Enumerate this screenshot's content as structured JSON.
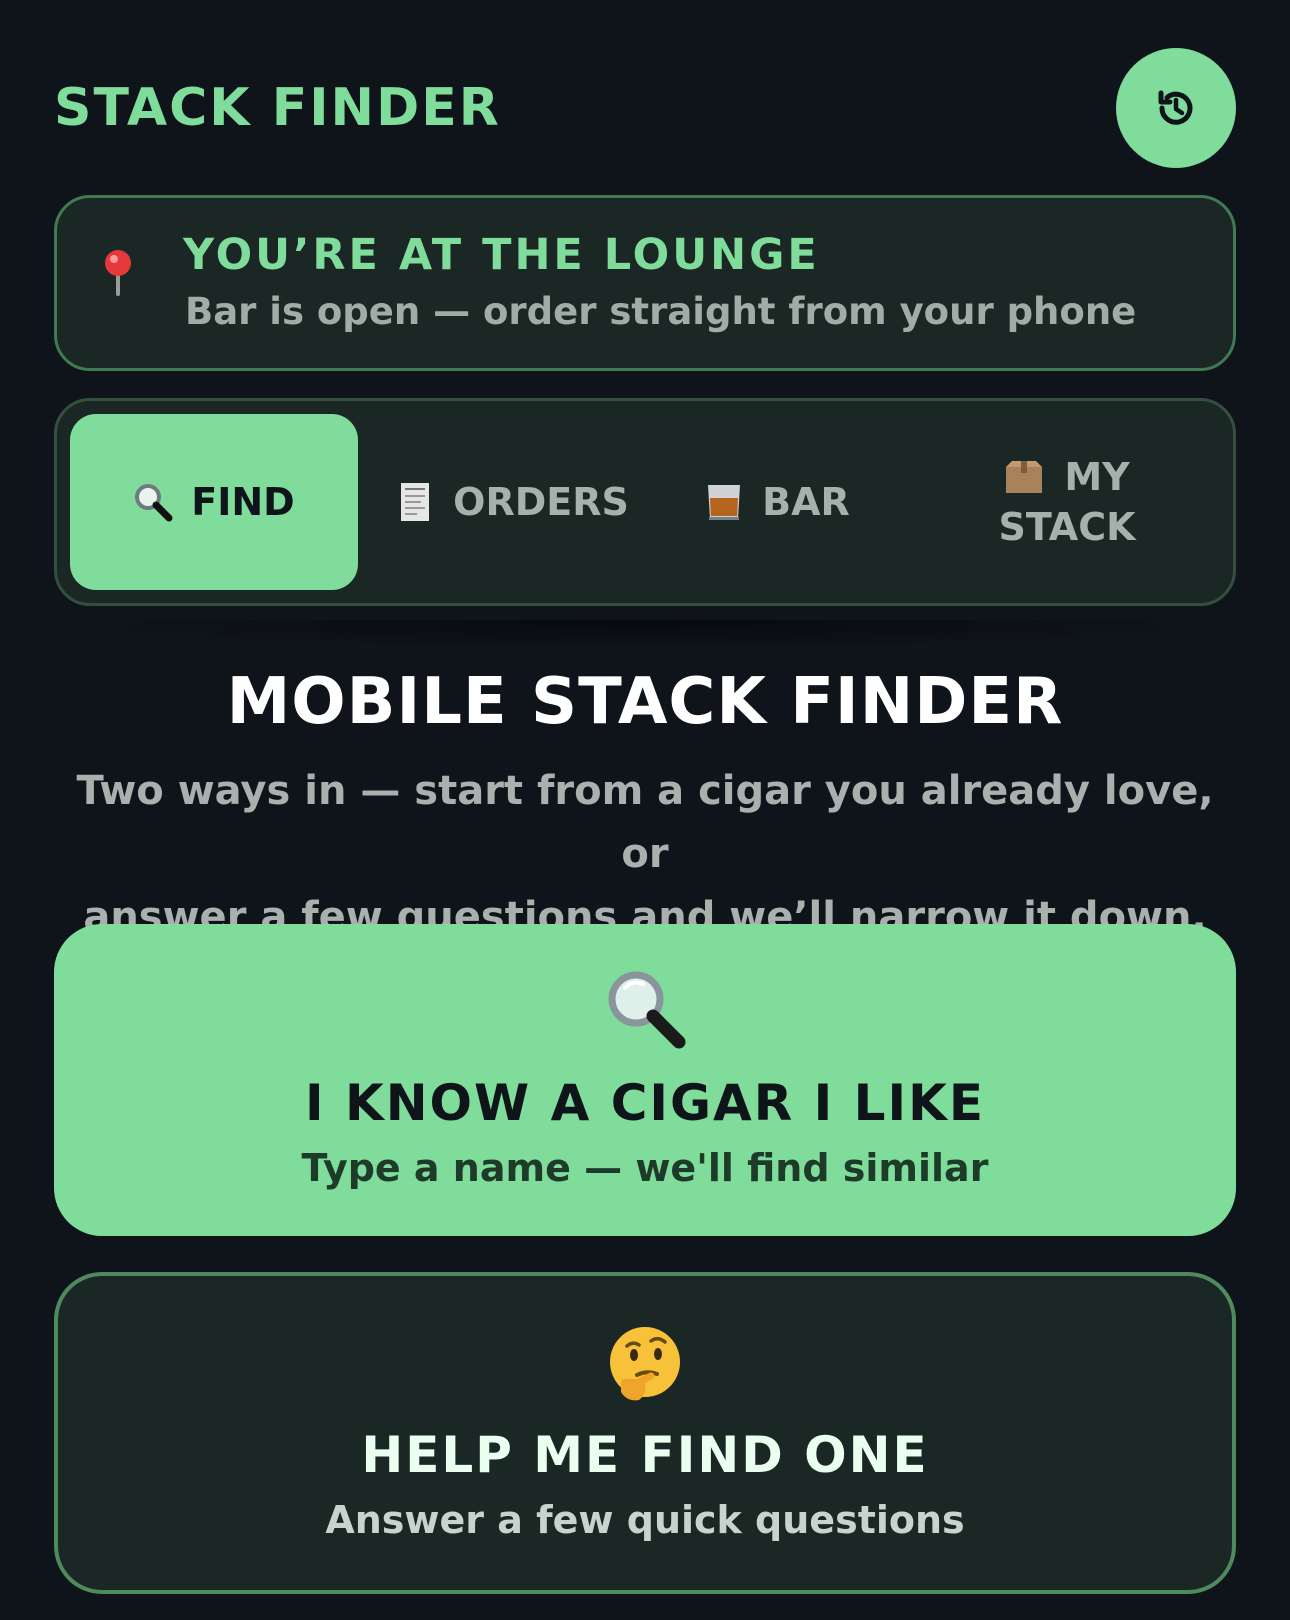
{
  "header": {
    "title": "STACK FINDER",
    "reset_icon": "history-icon"
  },
  "location": {
    "icon": "pin-icon",
    "title": "YOU’RE AT THE LOUNGE",
    "subtitle": "Bar is open — order straight from your phone"
  },
  "tabs": [
    {
      "icon": "magnifier-icon",
      "label": "FIND",
      "active": true
    },
    {
      "icon": "receipt-icon",
      "label": "ORDERS",
      "active": false
    },
    {
      "icon": "whiskey-glass-icon",
      "label": "BAR",
      "active": false
    },
    {
      "icon": "box-icon",
      "label_line1": "MY",
      "label_line2": "STACK",
      "active": false
    }
  ],
  "main": {
    "title": "MOBILE STACK FINDER",
    "subtitle_line1": "Two ways in — start from a cigar you already love, or",
    "subtitle_line2": "answer a few questions and we’ll narrow it down."
  },
  "options": {
    "known": {
      "icon": "magnifier-icon",
      "title": "I KNOW A CIGAR I LIKE",
      "subtitle": "Type a name — we'll find similar"
    },
    "help": {
      "icon": "thinking-face-icon",
      "title": "HELP ME FIND ONE",
      "subtitle": "Answer a few quick questions"
    }
  },
  "colors": {
    "accent": "#7fdc9a",
    "background": "#0f141a",
    "card": "#1b2724",
    "border": "#3f7a52"
  }
}
